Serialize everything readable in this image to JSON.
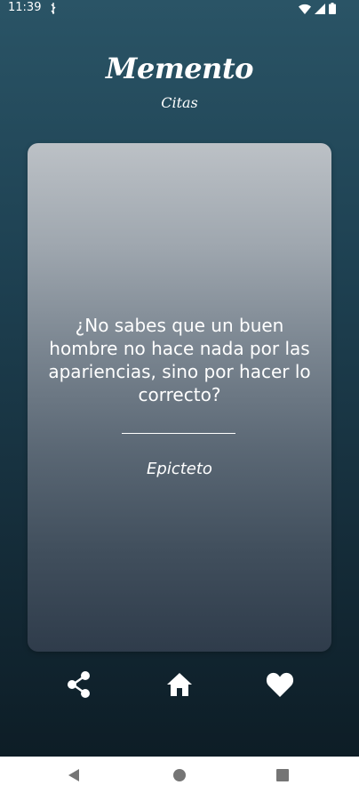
{
  "status_bar": {
    "time": "11:39"
  },
  "header": {
    "title": "Memento",
    "subtitle": "Citas"
  },
  "quote": {
    "text": "¿No sabes que un buen hombre no hace nada por las apariencias, sino por hacer lo correcto?",
    "author": "Epicteto"
  },
  "actions": {
    "share_icon": "share-icon",
    "home_icon": "home-icon",
    "favorite_icon": "heart-icon"
  },
  "nav_bar": {
    "back_icon": "triangle-back-icon",
    "home_icon": "circle-home-icon",
    "recents_icon": "square-recents-icon"
  },
  "colors": {
    "background_top": "#2a5466",
    "background_bottom": "#0d1d26",
    "card_top": "#bcc1c6",
    "card_bottom": "#2f3c4b",
    "text": "#ffffff",
    "nav_icon": "#757575"
  }
}
